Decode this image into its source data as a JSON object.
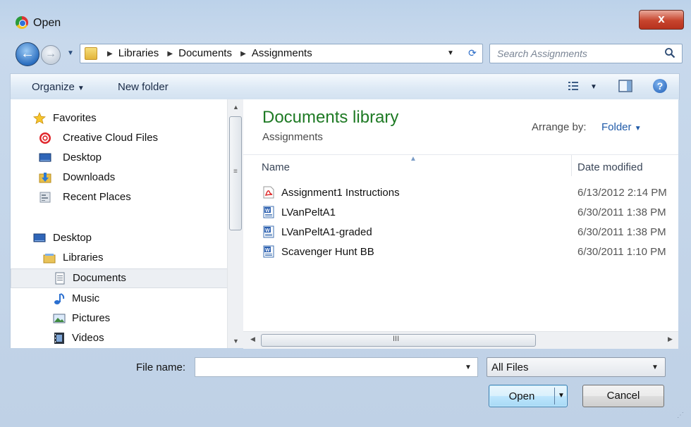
{
  "window": {
    "title": "Open",
    "close_label": "x"
  },
  "nav": {
    "back_arrow": "←",
    "forward_arrow": "→",
    "breadcrumbs": [
      "Libraries",
      "Documents",
      "Assignments"
    ],
    "search_placeholder": "Search Assignments"
  },
  "toolbar": {
    "organize_label": "Organize",
    "new_folder_label": "New folder",
    "help_label": "?"
  },
  "sidebar": {
    "items": [
      {
        "label": "Favorites",
        "icon": "star-icon"
      },
      {
        "label": "Creative Cloud Files",
        "icon": "creative-cloud-icon"
      },
      {
        "label": "Desktop",
        "icon": "desktop-icon"
      },
      {
        "label": "Downloads",
        "icon": "downloads-folder-icon"
      },
      {
        "label": "Recent Places",
        "icon": "recent-places-icon"
      },
      {
        "label": "Desktop",
        "icon": "desktop-icon"
      },
      {
        "label": "Libraries",
        "icon": "libraries-icon"
      },
      {
        "label": "Documents",
        "icon": "documents-icon"
      },
      {
        "label": "Music",
        "icon": "music-icon"
      },
      {
        "label": "Pictures",
        "icon": "pictures-icon"
      },
      {
        "label": "Videos",
        "icon": "videos-icon"
      }
    ],
    "selected": "Documents"
  },
  "library": {
    "title": "Documents library",
    "subtitle": "Assignments",
    "arrange_label": "Arrange by:",
    "arrange_value": "Folder"
  },
  "columns": {
    "name": "Name",
    "date": "Date modified"
  },
  "files": [
    {
      "name": "Assignment1 Instructions",
      "date": "6/13/2012 2:14 PM",
      "icon": "pdf-icon"
    },
    {
      "name": "LVanPeltA1",
      "date": "6/30/2011 1:38 PM",
      "icon": "word-doc-icon"
    },
    {
      "name": "LVanPeltA1-graded",
      "date": "6/30/2011 1:38 PM",
      "icon": "word-doc-icon"
    },
    {
      "name": "Scavenger Hunt BB",
      "date": "6/30/2011 1:10 PM",
      "icon": "word-doc-icon"
    }
  ],
  "footer": {
    "file_name_label": "File name:",
    "file_name_value": "",
    "file_type_value": "All Files",
    "open_label": "Open",
    "cancel_label": "Cancel"
  }
}
